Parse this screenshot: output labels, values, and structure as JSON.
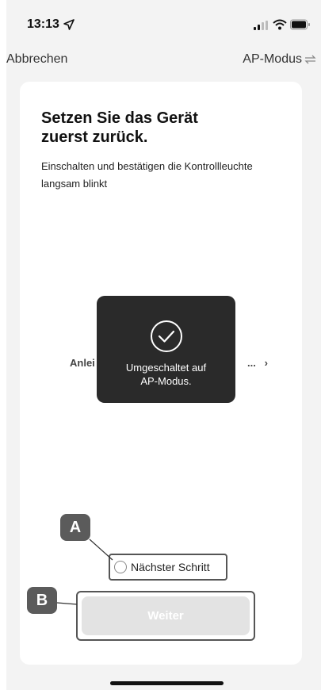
{
  "status_bar": {
    "time": "13:13",
    "icons": [
      "location-arrow-icon",
      "signal-icon",
      "wifi-icon",
      "battery-icon"
    ]
  },
  "nav": {
    "cancel_label": "Abbrechen",
    "mode_label": "AP-Modus",
    "mode_icon": "swap-arrows-icon"
  },
  "card": {
    "title_line1": "Setzen Sie das Gerät",
    "title_line2": "zuerst zurück.",
    "description": "Einschalten und bestätigen die Kontrollleuchte langsam blinkt",
    "guide_link_start": "Anlei",
    "guide_link_end": "...",
    "guide_arrow": "›"
  },
  "toast": {
    "icon": "check-circle-icon",
    "line1": "Umgeschaltet auf",
    "line2": "AP-Modus."
  },
  "next_step": {
    "label": "Nächster Schritt",
    "checked": false
  },
  "primary_button": {
    "label": "Weiter",
    "enabled": false
  },
  "callouts": {
    "a": "A",
    "b": "B"
  },
  "colors": {
    "toast_bg": "#2a2a2a",
    "callout_bg": "#5b5b5b",
    "button_disabled_bg": "#e3e3e3"
  }
}
